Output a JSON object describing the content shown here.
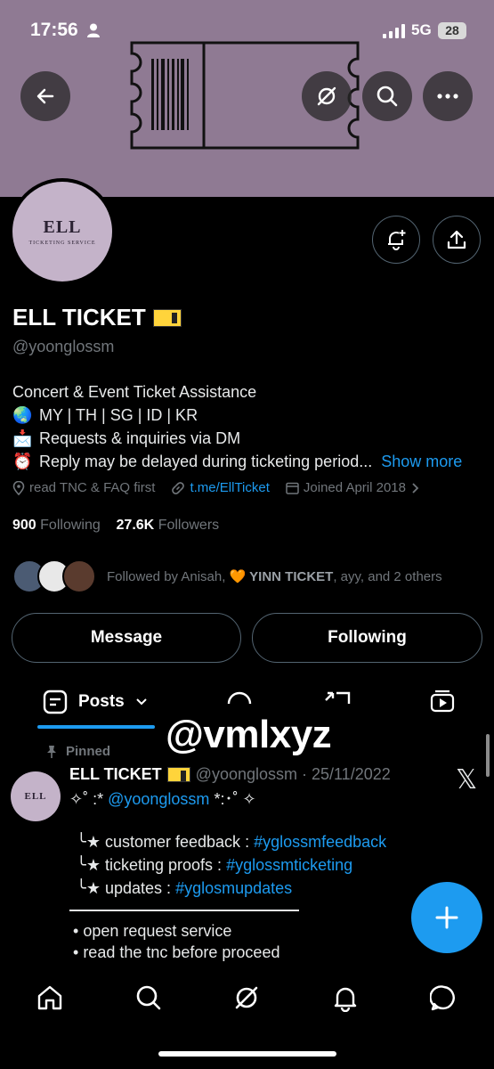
{
  "status_bar": {
    "time": "17:56",
    "network": "5G",
    "battery": "28"
  },
  "header": {
    "back_icon": "arrow-left-icon",
    "grok_icon": "grok-icon",
    "search_icon": "search-icon",
    "more_icon": "more-horizontal-icon"
  },
  "profile": {
    "avatar_logo_text": "ELL",
    "avatar_logo_subtext": "TICKETING SERVICE",
    "name": "ELL TICKET",
    "handle": "@yoonglossm",
    "bio": {
      "line1": "Concert & Event Ticket Assistance",
      "line2_emoji": "🌏",
      "line2": "MY | TH | SG | ID | KR",
      "line3_emoji": "📩",
      "line3": "Requests & inquiries via DM",
      "line4_emoji": "⏰",
      "line4": "Reply may be delayed during ticketing period...",
      "show_more": "Show more"
    },
    "location": "read TNC & FAQ first",
    "link": "t.me/EllTicket",
    "joined": "Joined April 2018",
    "following_count": "900",
    "following_label": "Following",
    "followers_count": "27.6K",
    "followers_label": "Followers",
    "followed_by_prefix": "Followed by Anisah, ",
    "followed_by_bold": "🧡 YINN TICKET",
    "followed_by_suffix": ", ayy, and 2 others"
  },
  "actions": {
    "message_label": "Message",
    "following_label": "Following"
  },
  "tabs": {
    "posts_label": "Posts"
  },
  "watermark": "@vmlxyz",
  "pinned_post": {
    "pinned_label": "Pinned",
    "author_name": "ELL TICKET",
    "meta": "@yoonglossm · 25/11/2022",
    "line1_prefix": "✧˚ :*",
    "line1_mention": "@yoonglossm",
    "line1_suffix": "*:･˚ ✧",
    "item1_label": "customer feedback :",
    "item1_tag": "#yglossmfeedback",
    "item2_label": "ticketing proofs   :",
    "item2_tag": "#yglossmticketing",
    "item3_label": "updates :",
    "item3_tag": "#yglosmupdates",
    "bullet1": "open request service",
    "bullet2": "read the tnc before proceed"
  },
  "bottom_nav": {
    "items": [
      "home-icon",
      "search-icon",
      "grok-icon",
      "notifications-icon",
      "messages-icon"
    ]
  },
  "colors": {
    "accent": "#1d9bf0",
    "banner": "#8f7a93",
    "background": "#000000"
  }
}
